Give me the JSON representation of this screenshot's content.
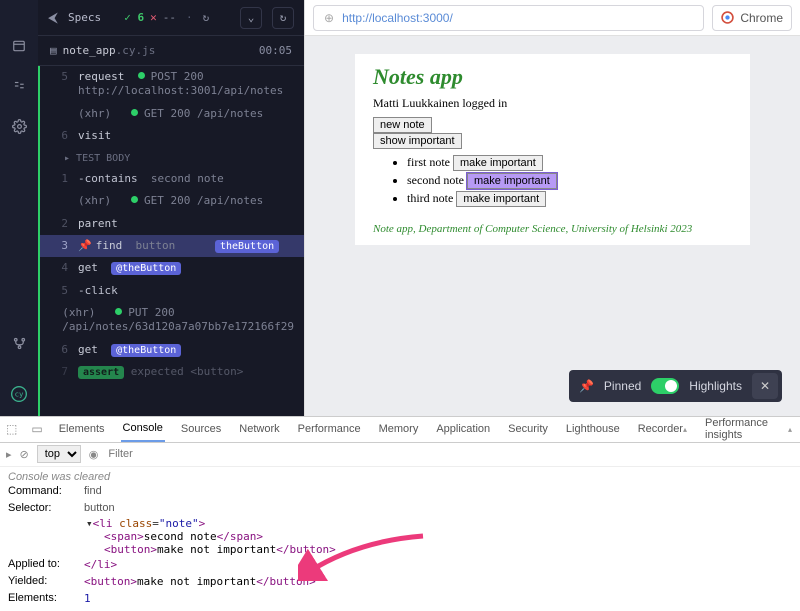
{
  "cypress": {
    "specs_label": "Specs",
    "pass_count": "6",
    "fail_glyph": "✕",
    "pending_dash": "--",
    "file_name": "note_app",
    "file_ext": ".cy.js",
    "timer": "00:05",
    "lines": {
      "l5_num": "5",
      "l5_cmd": "request",
      "l5_badge": "POST 200",
      "l5_url": "http://localhost:3001/api/notes",
      "xhr": "(xhr)",
      "get200": "GET 200 /api/notes",
      "l6_num": "6",
      "l6_cmd": "visit",
      "section": "TEST BODY",
      "l1_num": "1",
      "l1_cmd": "-contains",
      "l1_arg": "second note",
      "l2_num": "2",
      "l2_cmd": "parent",
      "l3_num": "3",
      "l3_cmd": "find",
      "l3_arg": "button",
      "l3_alias": "theButton",
      "l4_num": "4",
      "l4_cmd": "get",
      "l4_alias": "@theButton",
      "l5b_num": "5",
      "l5b_cmd": "-click",
      "put_badge": "PUT 200",
      "put_url": "/api/notes/63d120a7a07bb7e172166f29",
      "l6b_num": "6",
      "l6b_cmd": "get",
      "l6b_alias": "@theButton",
      "l7_num": "7",
      "l7_assert": "assert",
      "l7_rest": "expected <button>"
    }
  },
  "urlbar": {
    "url": "http://localhost:3000/",
    "browser": "Chrome"
  },
  "preview": {
    "heading": "Notes app",
    "logged_in": "Matti Luukkainen logged in",
    "btn_new_note": "new note",
    "btn_show_important": "show important",
    "notes": [
      {
        "text": "first note",
        "btn": "make important"
      },
      {
        "text": "second note",
        "btn": "make important"
      },
      {
        "text": "third note",
        "btn": "make important"
      }
    ],
    "footer": "Note app, Department of Computer Science, University of Helsinki 2023"
  },
  "floatbar": {
    "pinned": "Pinned",
    "highlights": "Highlights"
  },
  "devtools": {
    "tabs": [
      "Elements",
      "Console",
      "Sources",
      "Network",
      "Performance",
      "Memory",
      "Application",
      "Security",
      "Lighthouse",
      "Recorder",
      "Performance insights"
    ],
    "active_tab": "Console",
    "filter_placeholder": "Filter",
    "top_scope": "top",
    "cleared": "Console was cleared",
    "rows": {
      "command_label": "Command:",
      "command_val": "find",
      "selector_label": "Selector:",
      "selector_val": "button",
      "li_open": "<li class=\"note\">",
      "span_open": "<span>",
      "span_txt": "second note",
      "span_close": "</span>",
      "btn_open": "<button>",
      "btn_txt": "make not important",
      "btn_close": "</button>",
      "li_close": "</li>",
      "applied_label": "Applied to:",
      "yielded_label": "Yielded:",
      "elements_label": "Elements:",
      "elements_val": "1"
    }
  }
}
